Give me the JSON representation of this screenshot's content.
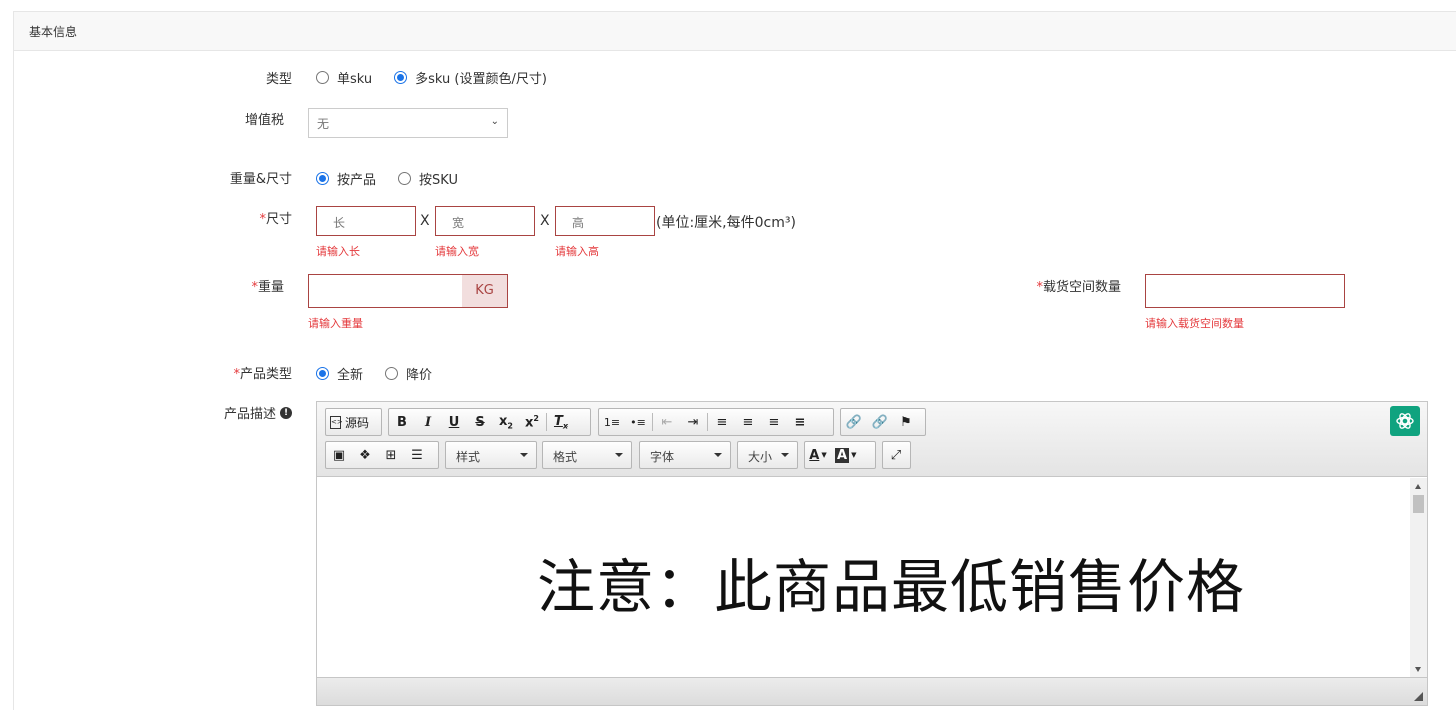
{
  "panel": {
    "title": "基本信息"
  },
  "type_field": {
    "label": "类型",
    "options": [
      {
        "label": "单sku",
        "selected": false
      },
      {
        "label": "多sku (设置颜色/尺寸)",
        "selected": true
      }
    ]
  },
  "vat_field": {
    "label": "增值税",
    "value": "无"
  },
  "weight_size_field": {
    "label": "重量&尺寸",
    "options": [
      {
        "label": "按产品",
        "selected": true
      },
      {
        "label": "按SKU",
        "selected": false
      }
    ]
  },
  "size_field": {
    "required_mark": "*",
    "label": "尺寸",
    "separator": "X",
    "unit_note": "(单位:厘米,每件0cm³)",
    "length": {
      "placeholder": "长",
      "error": "请输入长"
    },
    "width": {
      "placeholder": "宽",
      "error": "请输入宽"
    },
    "height": {
      "placeholder": "高",
      "error": "请输入高"
    }
  },
  "weight_field": {
    "required_mark": "*",
    "label": "重量",
    "addon": "KG",
    "error": "请输入重量"
  },
  "cargo_field": {
    "required_mark": "*",
    "label": "载货空间数量",
    "error": "请输入载货空间数量"
  },
  "product_type_field": {
    "required_mark": "*",
    "label": "产品类型",
    "options": [
      {
        "label": "全新",
        "selected": true
      },
      {
        "label": "降价",
        "selected": false
      }
    ]
  },
  "description_field": {
    "label": "产品描述"
  },
  "editor": {
    "source_label": "源码",
    "style_combo": "样式",
    "format_combo": "格式",
    "font_combo": "字体",
    "size_combo": "大小",
    "content_text": "注意：此商品最低销售价格"
  }
}
